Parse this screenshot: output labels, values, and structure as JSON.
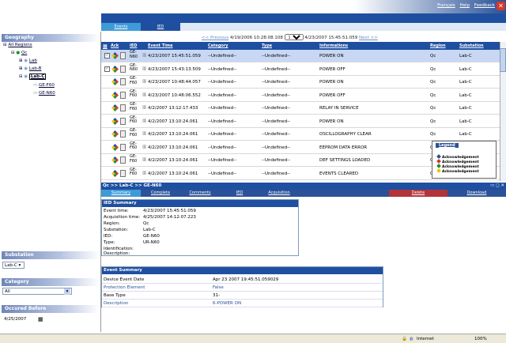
{
  "top_links": {
    "francais": "Français",
    "help": "Help",
    "feedback": "Feedback"
  },
  "tabs": {
    "events": "Events",
    "ied": "IED"
  },
  "nav": {
    "previous": "<< Previous",
    "from": "4/19/2006 10:28:08.108",
    "page_size": "100",
    "to": "4/23/2007 15:45:51.059",
    "next": "Next >>"
  },
  "left": {
    "geography_title": "Geography",
    "tree": {
      "all_regions": "All Regions",
      "qc": "Qc",
      "lab": "Lab",
      "lab_b": "Lab-B",
      "lab_c": "Lab-C",
      "ge_f60": "GE-F60",
      "ge_n60": "GE-N60"
    },
    "substation_title": "Substation",
    "substation_value": "Lab-C",
    "category_title": "Category",
    "category_value": "All",
    "occurred_title": "Occured Before",
    "occurred_value": "4/25/2007"
  },
  "grid": {
    "headers": {
      "ack": "Ack",
      "ied": "IED",
      "event_time": "Event Time",
      "category": "Category",
      "type": "Type",
      "informations": "Informations",
      "region": "Region",
      "substation": "Substation"
    },
    "rows": [
      {
        "ied_top": "GE-",
        "ied_bot": "N60",
        "time": "4/23/2007 15:45:51.059",
        "category": "--Undefined--",
        "type": "--Undefined--",
        "info": "POWER ON",
        "region": "Qc",
        "substation": "Lab-C"
      },
      {
        "ied_top": "GE-",
        "ied_bot": "N60",
        "time": "4/23/2007 15:43:13.509",
        "category": "--Undefined--",
        "type": "--Undefined--",
        "info": "POWER OFF",
        "region": "Qc",
        "substation": "Lab-C"
      },
      {
        "ied_top": "GE-",
        "ied_bot": "F60",
        "time": "4/23/2007 10:48:44.057",
        "category": "--Undefined--",
        "type": "--Undefined--",
        "info": "POWER ON",
        "region": "Qc",
        "substation": "Lab-C"
      },
      {
        "ied_top": "GE-",
        "ied_bot": "F60",
        "time": "4/23/2007 10:48:06.552",
        "category": "--Undefined--",
        "type": "--Undefined--",
        "info": "POWER OFF",
        "region": "Qc",
        "substation": "Lab-C"
      },
      {
        "ied_top": "GE-",
        "ied_bot": "F60",
        "time": "4/2/2007 13:12:17.433",
        "category": "--Undefined--",
        "type": "--Undefined--",
        "info": "RELAY IN SERVICE",
        "region": "Qc",
        "substation": "Lab-C"
      },
      {
        "ied_top": "GE-",
        "ied_bot": "F60",
        "time": "4/2/2007 13:10:24.061",
        "category": "--Undefined--",
        "type": "--Undefined--",
        "info": "POWER ON",
        "region": "Qc",
        "substation": "Lab-C"
      },
      {
        "ied_top": "GE-",
        "ied_bot": "F60",
        "time": "4/2/2007 13:10:24.061",
        "category": "--Undefined--",
        "type": "--Undefined--",
        "info": "OSCILLOGRAPHY CLEAR",
        "region": "Qc",
        "substation": "Lab-C"
      },
      {
        "ied_top": "GE-",
        "ied_bot": "F60",
        "time": "4/2/2007 13:10:24.061",
        "category": "--Undefined--",
        "type": "--Undefined--",
        "info": "EEPROM DATA ERROR",
        "region": "Q",
        "substation": ""
      },
      {
        "ied_top": "GE-",
        "ied_bot": "F60",
        "time": "4/2/2007 13:10:24.061",
        "category": "--Undefined--",
        "type": "--Undefined--",
        "info": "DEF SETTINGS LOADED",
        "region": "Q",
        "substation": ""
      },
      {
        "ied_top": "GE-",
        "ied_bot": "F60",
        "time": "4/2/2007 13:10:24.061",
        "category": "--Undefined--",
        "type": "--Undefined--",
        "info": "EVENTS CLEARED",
        "region": "Q",
        "substation": ""
      }
    ]
  },
  "legend": {
    "title": "Legend",
    "items": [
      "Acknowledgement",
      "Acknowledgement",
      "Acknowledgement",
      "Acknowledgement"
    ],
    "colors": [
      "#1f4fa0",
      "#d23a2a",
      "#2a8a2a",
      "#e6c700"
    ]
  },
  "detail": {
    "path": "Qc >> Lab-C >> GE-N60",
    "tabs": {
      "summary": "Summary",
      "complete": "Complete",
      "comments": "Comments",
      "ied": "IED",
      "acquisition": "Acquisition",
      "delete": "Delete",
      "download": "Download"
    },
    "ied_summary": {
      "title": "IED Summary",
      "event_time_label": "Event time:",
      "event_time": "4/23/2007 15:45:51.059",
      "acq_label": "Acquisition time:",
      "acq": "4/25/2007 14:12:07.223",
      "region_label": "Region:",
      "region": "Qc",
      "substation_label": "Substation:",
      "substation": "Lab-C",
      "ied_label": "IED:",
      "ied": "GE-N60",
      "type_label": "Type:",
      "type": "UR-N60",
      "identification_label": "Identification:",
      "description_label": "Description:"
    },
    "event_summary": {
      "title": "Event Summary",
      "rows": [
        {
          "label": "Device Event Date",
          "value": "Apr 23 2007 19:45:51.059029"
        },
        {
          "label": "Protection Element",
          "value": "False"
        },
        {
          "label": "Base Type",
          "value": "31-"
        },
        {
          "label": "Description",
          "value": "6-POWER ON"
        }
      ]
    }
  },
  "status": {
    "zone": "Internet",
    "zoom": "100%"
  }
}
